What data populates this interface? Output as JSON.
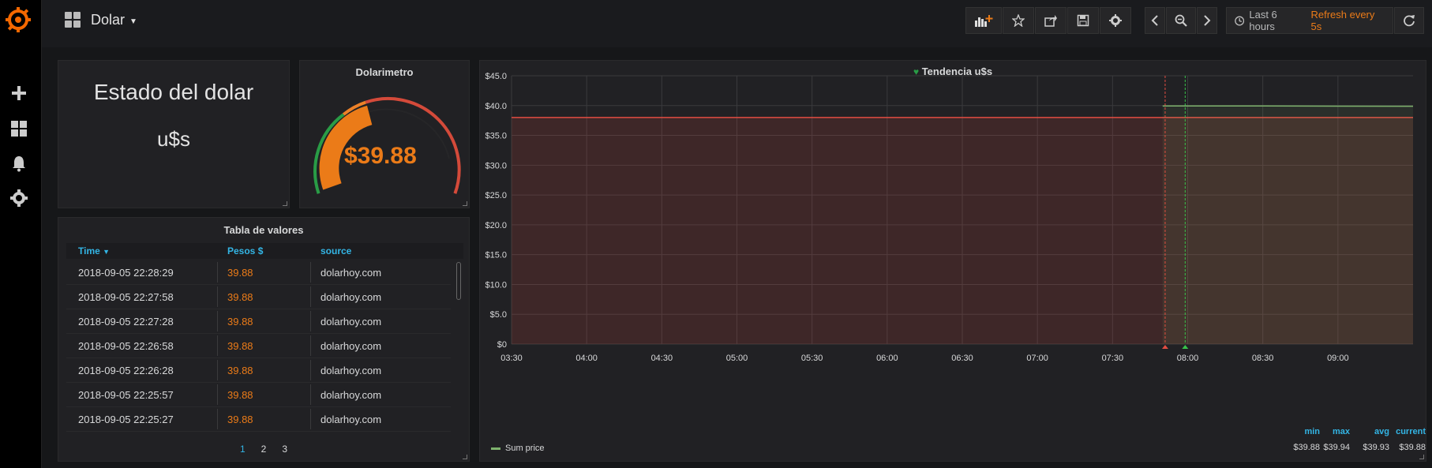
{
  "dashboard": {
    "title": "Dolar"
  },
  "toolbar": {
    "time_range": "Last 6 hours",
    "refresh": "Refresh every 5s"
  },
  "text_panel": {
    "line1": "Estado del dolar",
    "line2": "u$s"
  },
  "gauge_panel": {
    "title": "Dolarimetro",
    "value": "$39.88",
    "value_color": "#eb7b18"
  },
  "table_panel": {
    "title": "Tabla de valores",
    "columns": [
      "Time",
      "Pesos $",
      "source"
    ],
    "rows": [
      [
        "2018-09-05 22:28:29",
        "39.88",
        "dolarhoy.com"
      ],
      [
        "2018-09-05 22:27:58",
        "39.88",
        "dolarhoy.com"
      ],
      [
        "2018-09-05 22:27:28",
        "39.88",
        "dolarhoy.com"
      ],
      [
        "2018-09-05 22:26:58",
        "39.88",
        "dolarhoy.com"
      ],
      [
        "2018-09-05 22:26:28",
        "39.88",
        "dolarhoy.com"
      ],
      [
        "2018-09-05 22:25:57",
        "39.88",
        "dolarhoy.com"
      ],
      [
        "2018-09-05 22:25:27",
        "39.88",
        "dolarhoy.com"
      ]
    ],
    "pages": [
      "1",
      "2",
      "3"
    ]
  },
  "graph_panel": {
    "title": "Tendencia u$s",
    "legend": {
      "series": "Sum price",
      "headers": [
        "min",
        "max",
        "avg",
        "current"
      ],
      "values": [
        "$39.88",
        "$39.94",
        "$39.93",
        "$39.88"
      ]
    }
  },
  "chart_data": {
    "type": "line",
    "title": "Tendencia u$s",
    "x_tick_labels": [
      "03:30",
      "04:00",
      "04:30",
      "05:00",
      "05:30",
      "06:00",
      "06:30",
      "07:00",
      "07:30",
      "08:00",
      "08:30",
      "09:00"
    ],
    "y_tick_labels": [
      "$0",
      "$5.0",
      "$10.0",
      "$15.0",
      "$20.0",
      "$25.0",
      "$30.0",
      "$35.0",
      "$40.0",
      "$45.0"
    ],
    "ylim": [
      0,
      45
    ],
    "x_range": [
      "03:30",
      "09:30"
    ],
    "threshold": 38,
    "series": [
      {
        "name": "Sum price",
        "x": [
          "07:50",
          "08:30",
          "09:00",
          "09:30"
        ],
        "values": [
          39.94,
          39.93,
          39.9,
          39.88
        ]
      }
    ],
    "annotations": [
      "07:51",
      "07:59"
    ],
    "grid": true,
    "legend": "bottom-left",
    "colors": {
      "series": "#7eb26d",
      "threshold": "#e24d42",
      "annotation": "#e24d42",
      "annotation2": "#38c24a"
    }
  }
}
